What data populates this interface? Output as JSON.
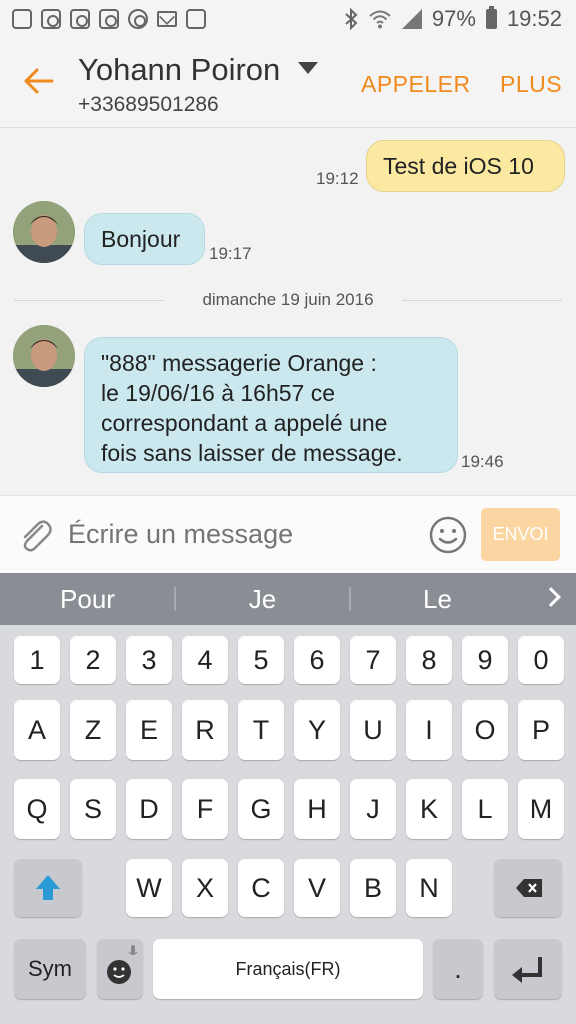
{
  "status_bar": {
    "left_icons": [
      "gallery-icon",
      "instagram-icon",
      "instagram-icon",
      "instagram-icon",
      "recorder-icon",
      "mail-icon",
      "case-icon"
    ],
    "battery": "97%",
    "time": "19:52"
  },
  "header": {
    "contact_name": "Yohann Poiron",
    "contact_number": "+33689501286",
    "call_label": "APPELER",
    "more_label": "PLUS"
  },
  "messages": [
    {
      "direction": "outgoing",
      "text": "Test de iOS 10",
      "time": "19:12"
    },
    {
      "direction": "incoming",
      "text": "Bonjour",
      "time": "19:17"
    },
    {
      "direction": "incoming",
      "lines": [
        "\"888\" messagerie Orange :",
        "le 19/06/16 à 16h57 ce",
        "correspondant a appelé une",
        "fois sans laisser de message."
      ],
      "time": "19:46"
    }
  ],
  "date_separator": "dimanche 19 juin 2016",
  "composer": {
    "placeholder": "Écrire un message",
    "send_label": "ENVOI"
  },
  "suggestions": [
    "Pour",
    "Je",
    "Le"
  ],
  "keyboard": {
    "row_numbers": [
      "1",
      "2",
      "3",
      "4",
      "5",
      "6",
      "7",
      "8",
      "9",
      "0"
    ],
    "row_1": [
      "A",
      "Z",
      "E",
      "R",
      "T",
      "Y",
      "U",
      "I",
      "O",
      "P"
    ],
    "row_2": [
      "Q",
      "S",
      "D",
      "F",
      "G",
      "H",
      "J",
      "K",
      "L",
      "M"
    ],
    "row_3": [
      "W",
      "X",
      "C",
      "V",
      "B",
      "N"
    ],
    "sym_label": "Sym",
    "space_label": "Français(FR)",
    "period_label": "."
  },
  "colors": {
    "accent": "#f08a1c",
    "outgoing_bubble": "#fbe9a2",
    "incoming_bubble": "#cbe8ef",
    "send_button": "#fbd6a2"
  }
}
